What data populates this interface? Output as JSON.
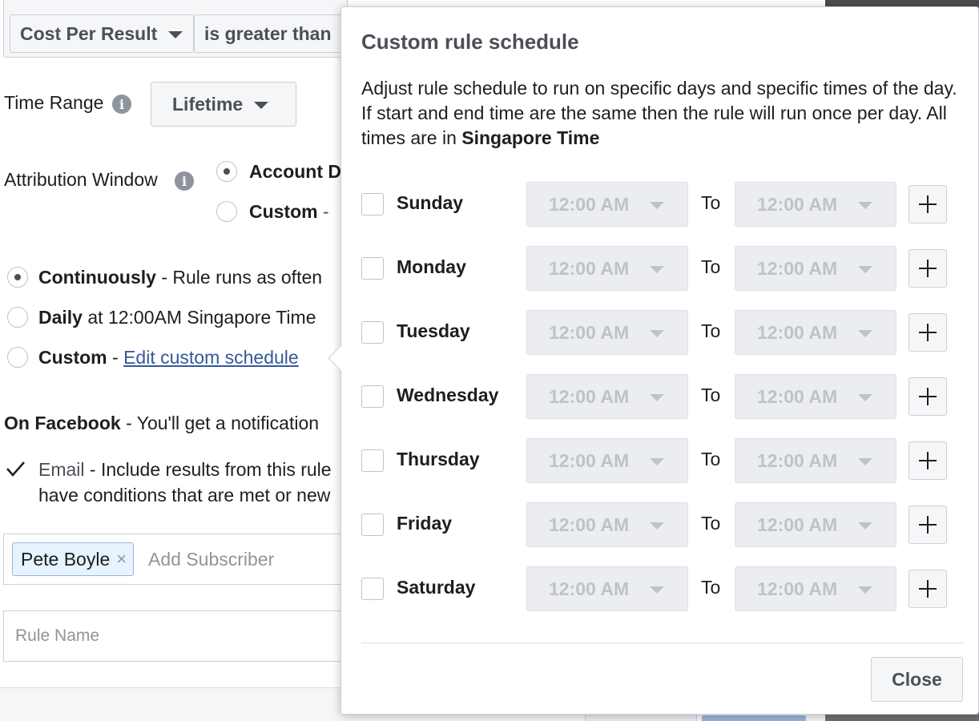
{
  "background": {
    "condition": {
      "metric": "Cost Per Result",
      "operator": "is greater than"
    },
    "time_range": {
      "label": "Time Range",
      "value": "Lifetime"
    },
    "attribution_window": {
      "label": "Attribution Window",
      "options": [
        "Account D",
        "Custom"
      ],
      "custom_suffix": "-"
    },
    "schedule": {
      "continuously_label": "Continuously",
      "continuously_desc": "- Rule runs as often",
      "daily_label": "Daily",
      "daily_desc": "at 12:00AM Singapore Time",
      "custom_label": "Custom",
      "custom_sep": "-",
      "custom_link": "Edit custom schedule"
    },
    "notification": {
      "heading": "On Facebook",
      "heading_desc": "- You'll get a notification",
      "email_label": "Email",
      "email_desc_line1": "- Include results from this rule",
      "email_desc_line2": "have conditions that are met or new"
    },
    "subscribers": {
      "token": "Pete Boyle",
      "remove_glyph": "×",
      "placeholder": "Add Subscriber"
    },
    "rule_name_placeholder": "Rule Name"
  },
  "dialog": {
    "title": "Custom rule schedule",
    "description": "Adjust rule schedule to run on specific days and specific times of the day. If start and end time are the same then the rule will run once per day. All times are in ",
    "timezone": "Singapore Time",
    "to_label": "To",
    "days": [
      {
        "name": "Sunday",
        "from": "12:00 AM",
        "to": "12:00 AM"
      },
      {
        "name": "Monday",
        "from": "12:00 AM",
        "to": "12:00 AM"
      },
      {
        "name": "Tuesday",
        "from": "12:00 AM",
        "to": "12:00 AM"
      },
      {
        "name": "Wednesday",
        "from": "12:00 AM",
        "to": "12:00 AM"
      },
      {
        "name": "Thursday",
        "from": "12:00 AM",
        "to": "12:00 AM"
      },
      {
        "name": "Friday",
        "from": "12:00 AM",
        "to": "12:00 AM"
      },
      {
        "name": "Saturday",
        "from": "12:00 AM",
        "to": "12:00 AM"
      }
    ],
    "close_label": "Close"
  }
}
